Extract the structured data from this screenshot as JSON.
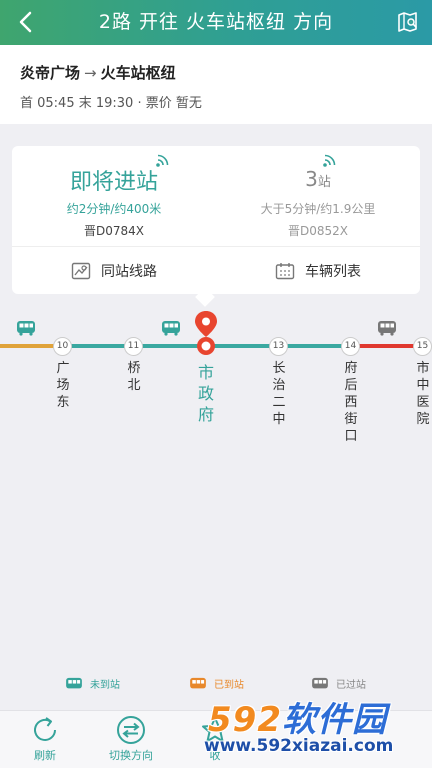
{
  "header": {
    "title": "2路 开往 火车站枢纽 方向",
    "back_icon": "chevron-left-icon",
    "map_icon": "map-search-icon"
  },
  "info": {
    "origin": "炎帝广场",
    "arrow": "→",
    "destination": "火车站枢纽",
    "times": "首 05:45 末 19:30 · 票价 暂无"
  },
  "buses": [
    {
      "status": "即将进站",
      "eta": "约2分钟/约400米",
      "plate": "晋D0784X"
    },
    {
      "status_number": "3",
      "status_unit": "站",
      "eta": "大于5分钟/约1.9公里",
      "plate": "晋D0852X"
    }
  ],
  "card_buttons": {
    "same_station_lines": "同站线路",
    "vehicle_list": "车辆列表"
  },
  "stops": [
    {
      "no": "10",
      "name": "广场东"
    },
    {
      "no": "11",
      "name": "桥北"
    },
    {
      "no": "",
      "name": "市政府",
      "current": true
    },
    {
      "no": "13",
      "name": "长治二中"
    },
    {
      "no": "14",
      "name": "府后西街口"
    },
    {
      "no": "15",
      "name": "市中医院"
    }
  ],
  "legend": {
    "not_arrived": "未到站",
    "arrived": "已到站",
    "passed": "已过站"
  },
  "tabs": {
    "refresh": "刷新",
    "switch_direction": "切换方向",
    "favorite": "收"
  },
  "watermark": {
    "logo_num": "592",
    "logo_text": "软件园",
    "url": "www.592xiazai.com"
  },
  "colors": {
    "accent": "#35a39a",
    "header_start": "#3fa56e",
    "header_end": "#2b9aa6",
    "line_teal": "#3aa8a0",
    "line_orange": "#e0a33a",
    "line_red": "#e0382f",
    "current_pin": "#e8452f",
    "bus_gray": "#777777",
    "bus_orange": "#e8882a"
  }
}
